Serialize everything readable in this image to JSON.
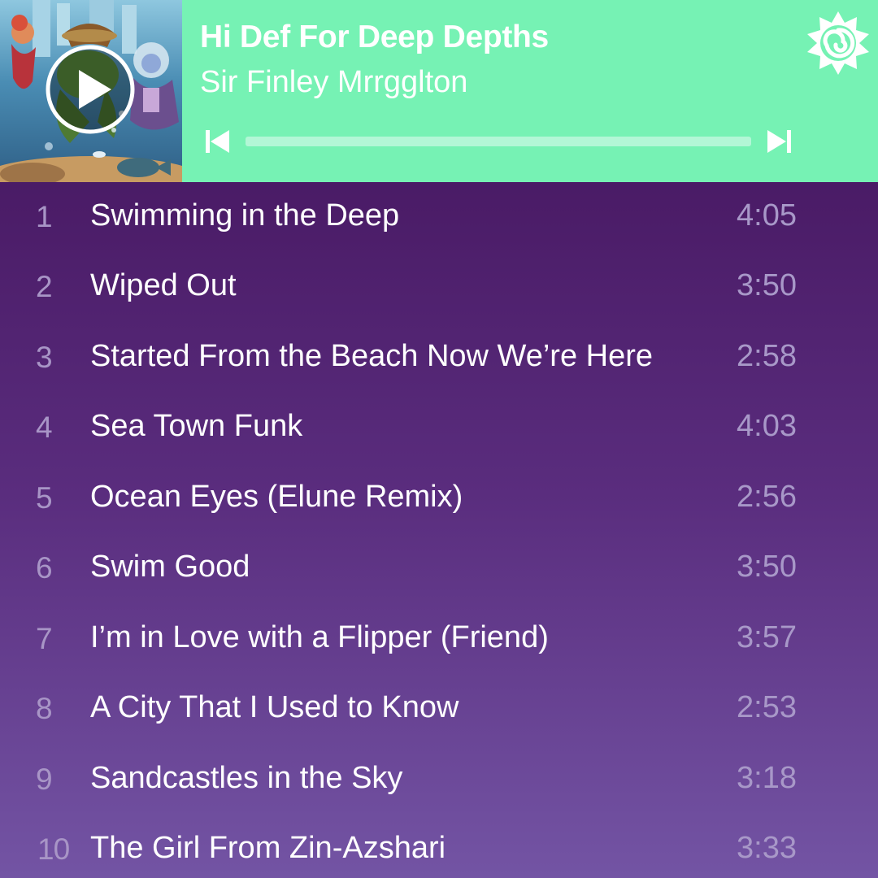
{
  "player": {
    "title": "Hi Def For Deep Depths",
    "artist": "Sir Finley Mrrgglton",
    "progress": 0,
    "controls": {
      "play_icon": "play-icon",
      "prev_icon": "skip-previous-icon",
      "next_icon": "skip-next-icon"
    },
    "brand_icon": "hearthstone-logo-icon"
  },
  "colors": {
    "header_bg": "#76f2b4",
    "progress_track": "#b2f7d6",
    "list_gradient_top": "#4a1b66",
    "list_gradient_bottom": "#7354a4",
    "track_text": "#ffffff",
    "muted_text": "#a898c8"
  },
  "tracks": [
    {
      "number": "1",
      "name": "Swimming in the Deep",
      "duration": "4:05"
    },
    {
      "number": "2",
      "name": "Wiped Out",
      "duration": "3:50"
    },
    {
      "number": "3",
      "name": "Started From the Beach Now We’re Here",
      "duration": "2:58"
    },
    {
      "number": "4",
      "name": "Sea Town Funk",
      "duration": "4:03"
    },
    {
      "number": "5",
      "name": "Ocean Eyes (Elune Remix)",
      "duration": "2:56"
    },
    {
      "number": "6",
      "name": "Swim Good",
      "duration": "3:50"
    },
    {
      "number": "7",
      "name": "I’m in Love with a Flipper (Friend)",
      "duration": "3:57"
    },
    {
      "number": "8",
      "name": "A City That I Used to Know",
      "duration": "2:53"
    },
    {
      "number": "9",
      "name": "Sandcastles in the Sky",
      "duration": "3:18"
    },
    {
      "number": "10",
      "name": "The Girl From Zin-Azshari",
      "duration": "3:33"
    }
  ]
}
